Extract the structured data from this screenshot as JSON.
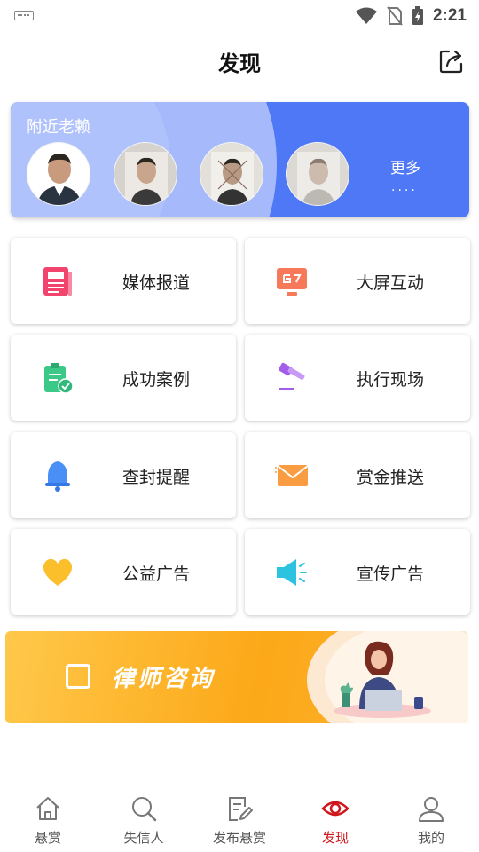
{
  "status_bar": {
    "time": "2:21"
  },
  "header": {
    "title": "发现"
  },
  "nearby": {
    "label": "附近老赖",
    "more": "更多",
    "dots": "····"
  },
  "grid": [
    {
      "label": "媒体报道",
      "icon": "newspaper-icon"
    },
    {
      "label": "大屏互动",
      "icon": "monitor-icon"
    },
    {
      "label": "成功案例",
      "icon": "clipboard-check-icon"
    },
    {
      "label": "执行现场",
      "icon": "gavel-icon"
    },
    {
      "label": "查封提醒",
      "icon": "bell-icon"
    },
    {
      "label": "赏金推送",
      "icon": "envelope-icon"
    },
    {
      "label": "公益广告",
      "icon": "heart-icon"
    },
    {
      "label": "宣传广告",
      "icon": "megaphone-icon"
    }
  ],
  "lawyer_banner": {
    "text": "律师咨询"
  },
  "nav": [
    {
      "label": "悬赏",
      "icon": "home-icon"
    },
    {
      "label": "失信人",
      "icon": "search-icon"
    },
    {
      "label": "发布悬赏",
      "icon": "edit-doc-icon"
    },
    {
      "label": "发现",
      "icon": "eye-icon",
      "active": true
    },
    {
      "label": "我的",
      "icon": "user-icon"
    }
  ],
  "colors": {
    "accent": "#d0171d",
    "banner_blue": "#4f78f6",
    "banner_orange": "#fca818"
  }
}
